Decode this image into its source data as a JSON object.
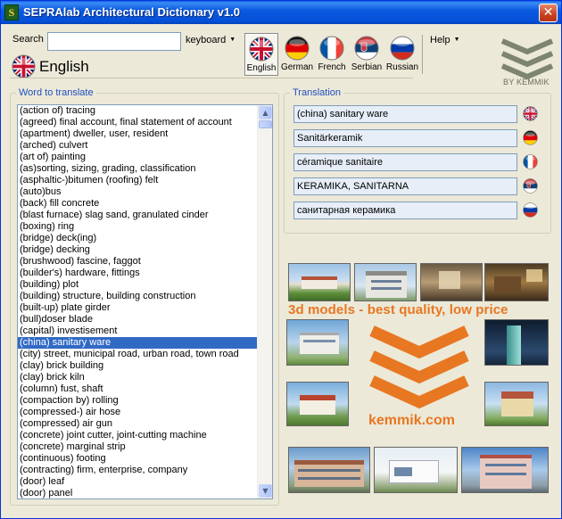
{
  "window": {
    "title": "SEPRAlab Architectural Dictionary v1.0",
    "close_glyph": "✕"
  },
  "search": {
    "label": "Search",
    "value": "",
    "keyboard_label": "keyboard"
  },
  "current_language": {
    "name": "English",
    "flag": "uk-flag-icon"
  },
  "languages": [
    {
      "label": "English",
      "flag": "uk-flag-icon",
      "active": true
    },
    {
      "label": "German",
      "flag": "germany-flag-icon",
      "active": false
    },
    {
      "label": "French",
      "flag": "france-flag-icon",
      "active": false
    },
    {
      "label": "Serbian",
      "flag": "serbia-flag-icon",
      "active": false
    },
    {
      "label": "Russian",
      "flag": "russia-flag-icon",
      "active": false
    }
  ],
  "help_label": "Help",
  "logo_caption": "BY KEMMIK",
  "word_panel": {
    "title": "Word to translate",
    "selected_index": 20,
    "items": [
      "(action of) tracing",
      "(agreed) final account, final statement of account",
      "(apartment) dweller, user, resident",
      "(arched) culvert",
      "(art of) painting",
      "(as)sorting, sizing, grading, classification",
      "(asphaltic-)bitumen (roofing) felt",
      "(auto)bus",
      "(back) fill concrete",
      "(blast furnace) slag sand, granulated cinder",
      "(boxing) ring",
      "(bridge) deck(ing)",
      "(bridge) decking",
      "(brushwood) fascine, faggot",
      "(builder's) hardware, fittings",
      "(building) plot",
      "(building) structure, building construction",
      "(built-up) plate girder",
      "(bull)doser blade",
      "(capital) investisement",
      "(china) sanitary ware",
      "(city) street, municipal road, urban road, town road",
      "(clay) brick building",
      "(clay) brick kiln",
      "(column) fust, shaft",
      "(compaction by) rolling",
      "(compressed-) air hose",
      "(compressed) air gun",
      "(concrete) joint cutter, joint-cutting machine",
      "(concrete) marginal strip",
      "(continuous) footing",
      "(contracting) firm, enterprise, company",
      "(door) leaf",
      "(door) panel"
    ]
  },
  "translation_panel": {
    "title": "Translation",
    "rows": [
      {
        "text": "(china) sanitary ware",
        "flag": "uk-flag-icon"
      },
      {
        "text": "Sanitärkeramik",
        "flag": "germany-flag-icon"
      },
      {
        "text": "céramique sanitaire",
        "flag": "france-flag-icon"
      },
      {
        "text": "KERAMIKA, SANITARNA",
        "flag": "serbia-flag-icon"
      },
      {
        "text": "санитарная керамика",
        "flag": "russia-flag-icon"
      }
    ]
  },
  "ad": {
    "slogan": "3d models - best quality, low price",
    "brand": "kemmik.com",
    "color": "#E87722"
  },
  "colors": {
    "titlebar": "#0550D8",
    "selection": "#316AC5",
    "group_title": "#1F4FBF",
    "background": "#ECE9D8"
  }
}
